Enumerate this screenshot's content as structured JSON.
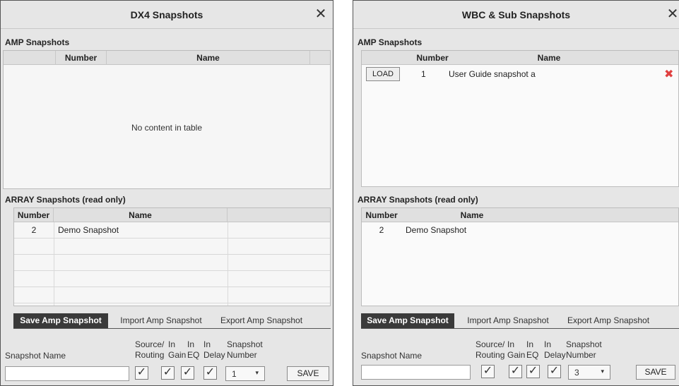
{
  "dx4": {
    "title": "DX4 Snapshots",
    "close_icon": "close-icon",
    "amp_heading": "AMP Snapshots",
    "amp_columns": [
      "Number",
      "Name"
    ],
    "amp_empty": "No content in table",
    "array_heading": "ARRAY Snapshots (read only)",
    "array_columns": [
      "Number",
      "Name"
    ],
    "array_rows": [
      {
        "number": "2",
        "name": "Demo Snapshot"
      }
    ],
    "tabs": [
      "Save Amp Snapshot",
      "Import Amp Snapshot",
      "Export Amp Snapshot"
    ],
    "active_tab": 0,
    "form": {
      "snapshot_name_label": "Snapshot Name",
      "source_routing_label_1": "Source/",
      "source_routing_label_2": "Routing",
      "in_gain_label_1": "In",
      "in_gain_label_2": "Gain",
      "in_eq_label_1": "In",
      "in_eq_label_2": "EQ",
      "in_delay_label_1": "In",
      "in_delay_label_2": "Delay",
      "snapshot_number_label_1": "Snapshot",
      "snapshot_number_label_2": "Number",
      "snapshot_name_value": "",
      "checkbox_glyph": "✓",
      "snapshot_number_value": "1",
      "dropdown_glyph": "▾",
      "save_label": "SAVE"
    }
  },
  "wbc": {
    "title": "WBC & Sub Snapshots",
    "close_icon": "close-icon",
    "amp_heading": "AMP Snapshots",
    "amp_columns": [
      "Number",
      "Name"
    ],
    "amp_rows": [
      {
        "load_label": "LOAD",
        "number": "1",
        "name": "User Guide snapshot a",
        "delete_glyph": "✖"
      }
    ],
    "array_heading": "ARRAY Snapshots (read only)",
    "array_columns": [
      "Number",
      "Name"
    ],
    "array_rows": [
      {
        "number": "2",
        "name": "Demo Snapshot"
      }
    ],
    "tabs": [
      "Save Amp Snapshot",
      "Import Amp Snapshot",
      "Export Amp Snapshot"
    ],
    "active_tab": 0,
    "form": {
      "snapshot_name_label": "Snapshot Name",
      "source_routing_label_1": "Source/",
      "source_routing_label_2": "Routing",
      "in_gain_label_1": "In",
      "in_gain_label_2": "Gain",
      "in_eq_label_1": "In",
      "in_eq_label_2": "EQ",
      "in_delay_label_1": "In",
      "in_delay_label_2": "Delay",
      "snapshot_number_label_1": "Snapshot",
      "snapshot_number_label_2": "Number",
      "snapshot_name_value": "",
      "checkbox_glyph": "✓",
      "snapshot_number_value": "3",
      "dropdown_glyph": "▾",
      "save_label": "SAVE"
    }
  }
}
